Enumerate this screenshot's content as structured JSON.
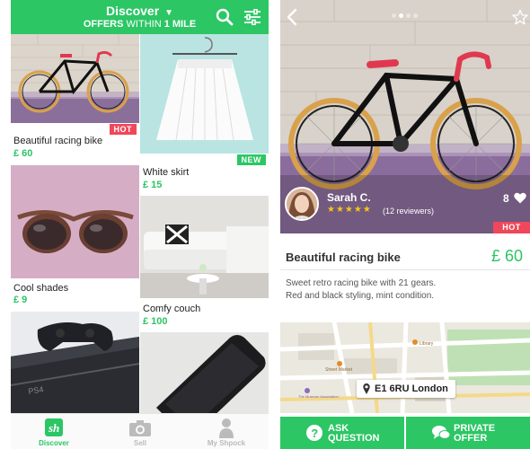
{
  "discover": {
    "header": {
      "title": "Discover",
      "subtitle_a": "OFFERS",
      "subtitle_b": "WITHIN",
      "subtitle_c": "1 MILE",
      "dropdown_glyph": "▼",
      "search_icon": "search-icon",
      "filter_icon": "filter-sliders-icon"
    },
    "items": [
      {
        "name": "Beautiful racing bike",
        "price": "£ 60",
        "tag": "HOT"
      },
      {
        "name": "White skirt",
        "price": "£ 15",
        "tag": "NEW"
      },
      {
        "name": "Cool shades",
        "price": "£ 9",
        "tag": ""
      },
      {
        "name": "Comfy couch",
        "price": "£ 100",
        "tag": ""
      }
    ],
    "nav": [
      {
        "label": "Discover",
        "icon": "shpock-logo-icon",
        "active": true
      },
      {
        "label": "Sell",
        "icon": "camera-icon",
        "active": false
      },
      {
        "label": "My Shpock",
        "icon": "person-icon",
        "active": false
      }
    ]
  },
  "detail": {
    "back_icon": "back-chevron-icon",
    "favorite_icon": "star-outline-icon",
    "carousel_pages": 4,
    "carousel_active": 1,
    "seller": {
      "name": "Sarah C.",
      "stars": "★★★★★",
      "reviews": "(12 reviewers)"
    },
    "likes": "8",
    "tag": "HOT",
    "title": "Beautiful racing bike",
    "price": "£ 60",
    "description_1": "Sweet retro racing bike with 21 gears.",
    "description_2": "Red and black styling, mint condition.",
    "location": "E1 6RU London",
    "map_labels": [
      "Library",
      "Street Market",
      "The Museum Association"
    ],
    "actions": [
      {
        "line1": "ASK",
        "line2": "QUESTION",
        "icon": "question-icon"
      },
      {
        "line1": "PRIVATE",
        "line2": "OFFER",
        "icon": "chat-bubbles-icon"
      }
    ]
  },
  "colors": {
    "brand_green": "#2cc665",
    "hot_red": "#f0475a",
    "star_gold": "#f5c518"
  }
}
